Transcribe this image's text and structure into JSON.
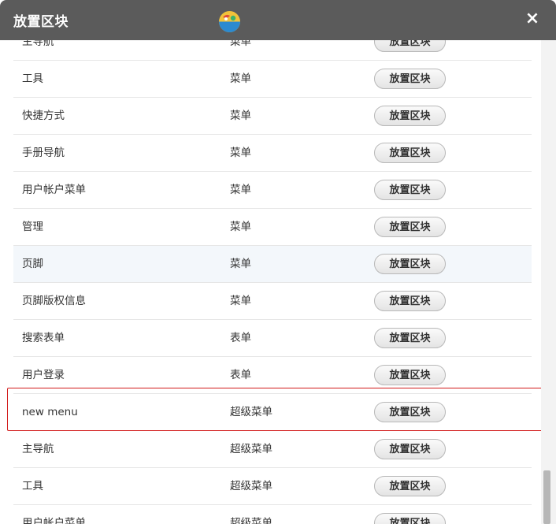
{
  "dialog": {
    "title": "放置区块",
    "close_label": "×"
  },
  "rows": [
    {
      "name": "主导航",
      "category": "菜单",
      "action": "放置区块"
    },
    {
      "name": "工具",
      "category": "菜单",
      "action": "放置区块"
    },
    {
      "name": "快捷方式",
      "category": "菜单",
      "action": "放置区块"
    },
    {
      "name": "手册导航",
      "category": "菜单",
      "action": "放置区块"
    },
    {
      "name": "用户帐户菜单",
      "category": "菜单",
      "action": "放置区块"
    },
    {
      "name": "管理",
      "category": "菜单",
      "action": "放置区块"
    },
    {
      "name": "页脚",
      "category": "菜单",
      "action": "放置区块"
    },
    {
      "name": "页脚版权信息",
      "category": "菜单",
      "action": "放置区块"
    },
    {
      "name": "搜索表单",
      "category": "表单",
      "action": "放置区块"
    },
    {
      "name": "用户登录",
      "category": "表单",
      "action": "放置区块"
    },
    {
      "name": "new menu",
      "category": "超级菜单",
      "action": "放置区块"
    },
    {
      "name": "主导航",
      "category": "超级菜单",
      "action": "放置区块"
    },
    {
      "name": "工具",
      "category": "超级菜单",
      "action": "放置区块"
    },
    {
      "name": "用户帐户菜单",
      "category": "超级菜单",
      "action": "放置区块"
    }
  ],
  "colors": {
    "titlebar": "#5b5b5b",
    "highlight": "#d21b1b",
    "hover_row": "#f3f7fb"
  },
  "icons": {
    "logo": "drupal-drop-logo-icon",
    "close": "close-icon"
  }
}
